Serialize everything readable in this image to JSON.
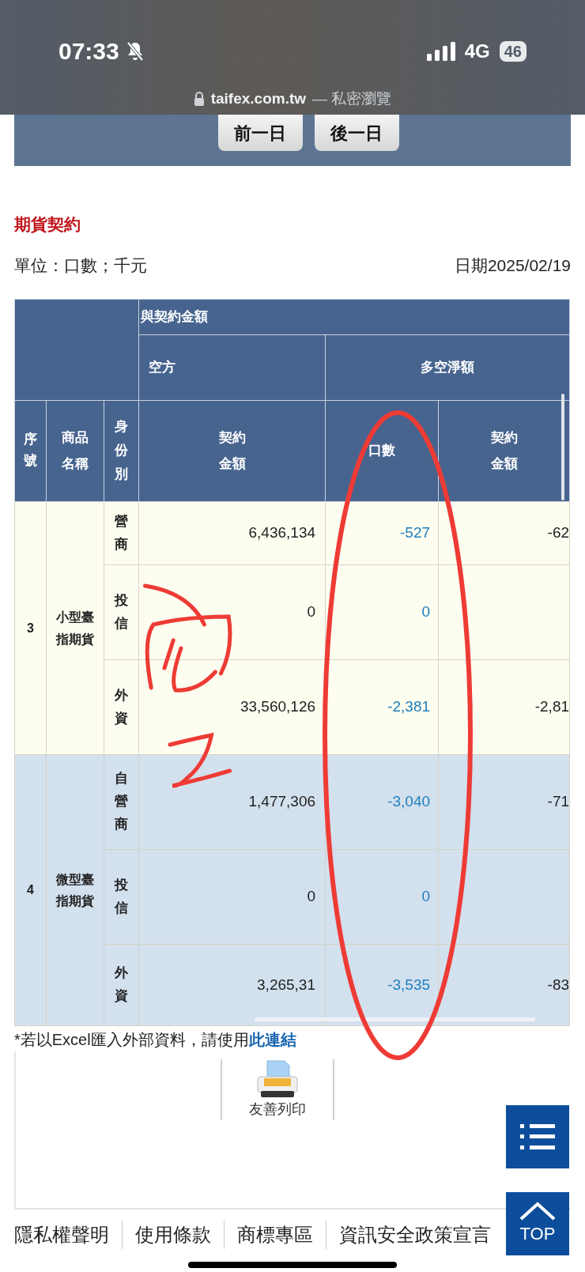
{
  "status_bar": {
    "time": "07:33",
    "network": "4G",
    "battery": "46"
  },
  "browser": {
    "url": "taifex.com.tw",
    "mode": "— 私密瀏覽"
  },
  "nav_buttons": [
    "前一日",
    "後一日"
  ],
  "section_title": "期貨契約",
  "unit": "單位：口數；千元",
  "date": "日期2025/02/19",
  "table": {
    "header_top": "與契約金額",
    "header_groups": [
      "空方",
      "多空淨額"
    ],
    "columns": [
      "序號",
      "商品名稱",
      "身份別",
      "契約金額",
      "口數",
      "契約金額"
    ],
    "groups": [
      {
        "index": "3",
        "product": "小型臺指期貨",
        "rows": [
          {
            "identity": "營商",
            "amount": "6,436,134",
            "net_lots": "-527",
            "net_amount": "-62"
          },
          {
            "identity": "投信",
            "amount": "0",
            "net_lots": "0"
          },
          {
            "identity": "外資",
            "amount": "33,560,126",
            "net_lots": "-2,381",
            "net_amount": "-2,81"
          }
        ]
      },
      {
        "index": "4",
        "product": "微型臺指期貨",
        "rows": [
          {
            "identity": "自營商",
            "amount": "1,477,306",
            "net_lots": "-3,040",
            "net_amount": "-71"
          },
          {
            "identity": "投信",
            "amount": "0",
            "net_lots": "0"
          },
          {
            "identity": "外資",
            "amount": "3,265,31",
            "net_lots": "-3,535",
            "net_amount": "-83"
          }
        ]
      }
    ]
  },
  "footnote": {
    "text": "*若以Excel匯入外部資料，請使用",
    "link": "此連結"
  },
  "print_label": "友善列印",
  "top_label": "TOP",
  "footer_links": [
    "隱私權聲明",
    "使用條款",
    "商標專區",
    "資訊安全政策宣言"
  ]
}
